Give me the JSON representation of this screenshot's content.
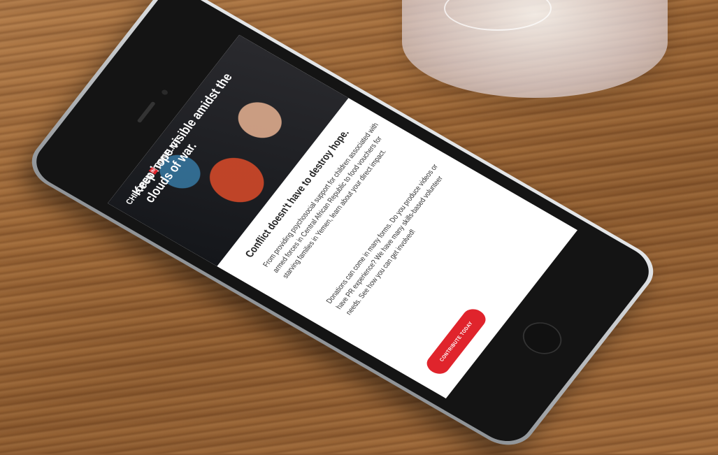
{
  "hero": {
    "title": "Keep hope visible amidst the clouds of war.",
    "logo_top": "CHILDREN",
    "logo_in": "IN",
    "logo_bottom": "CONFLICT"
  },
  "content": {
    "heading": "Conflict doesn't have to destroy hope.",
    "paragraph_1": "From providing psychosocial support for children associated with armed forces in Central African Republic to food vouchers for starving families in Yemen, learn about your direct impact.",
    "paragraph_2": "Donations can come in many forms. Do you produce videos or have PR experience? We have many skills-based volunteer needs. See how you can get involved!",
    "cta_label": "CONTRIBUTE TODAY"
  },
  "colors": {
    "accent": "#e0242c",
    "wood": "#9a6535"
  },
  "icons": [
    "home-button-icon",
    "camera-icon",
    "speaker-icon"
  ]
}
